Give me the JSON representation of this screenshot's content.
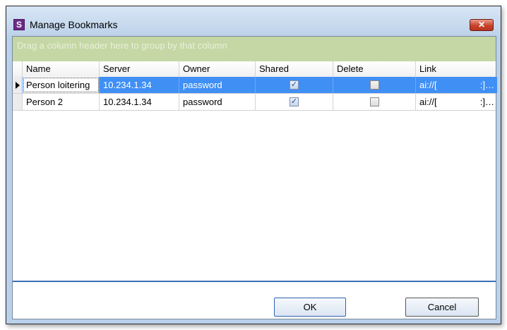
{
  "window": {
    "title": "Manage Bookmarks",
    "app_icon_letter": "S",
    "close_glyph": "✕"
  },
  "group_panel": {
    "hint": "Drag a column header here to group by that column"
  },
  "grid": {
    "columns": [
      "Name",
      "Server",
      "Owner",
      "Shared",
      "Delete",
      "Link"
    ],
    "rows": [
      {
        "name": "Person loitering",
        "server": "10.234.1.34",
        "owner": "password",
        "shared": true,
        "delete": false,
        "link": "ai://[",
        "link_tail": ":]…",
        "selected": true
      },
      {
        "name": "Person 2",
        "server": "10.234.1.34",
        "owner": "password",
        "shared": true,
        "delete": false,
        "link": "ai://[",
        "link_tail": ":]…",
        "selected": false
      }
    ]
  },
  "buttons": {
    "ok": "OK",
    "cancel": "Cancel"
  },
  "colors": {
    "selection": "#3f8ff5",
    "group_panel": "#c5d7a4",
    "close_button": "#c7432b"
  }
}
